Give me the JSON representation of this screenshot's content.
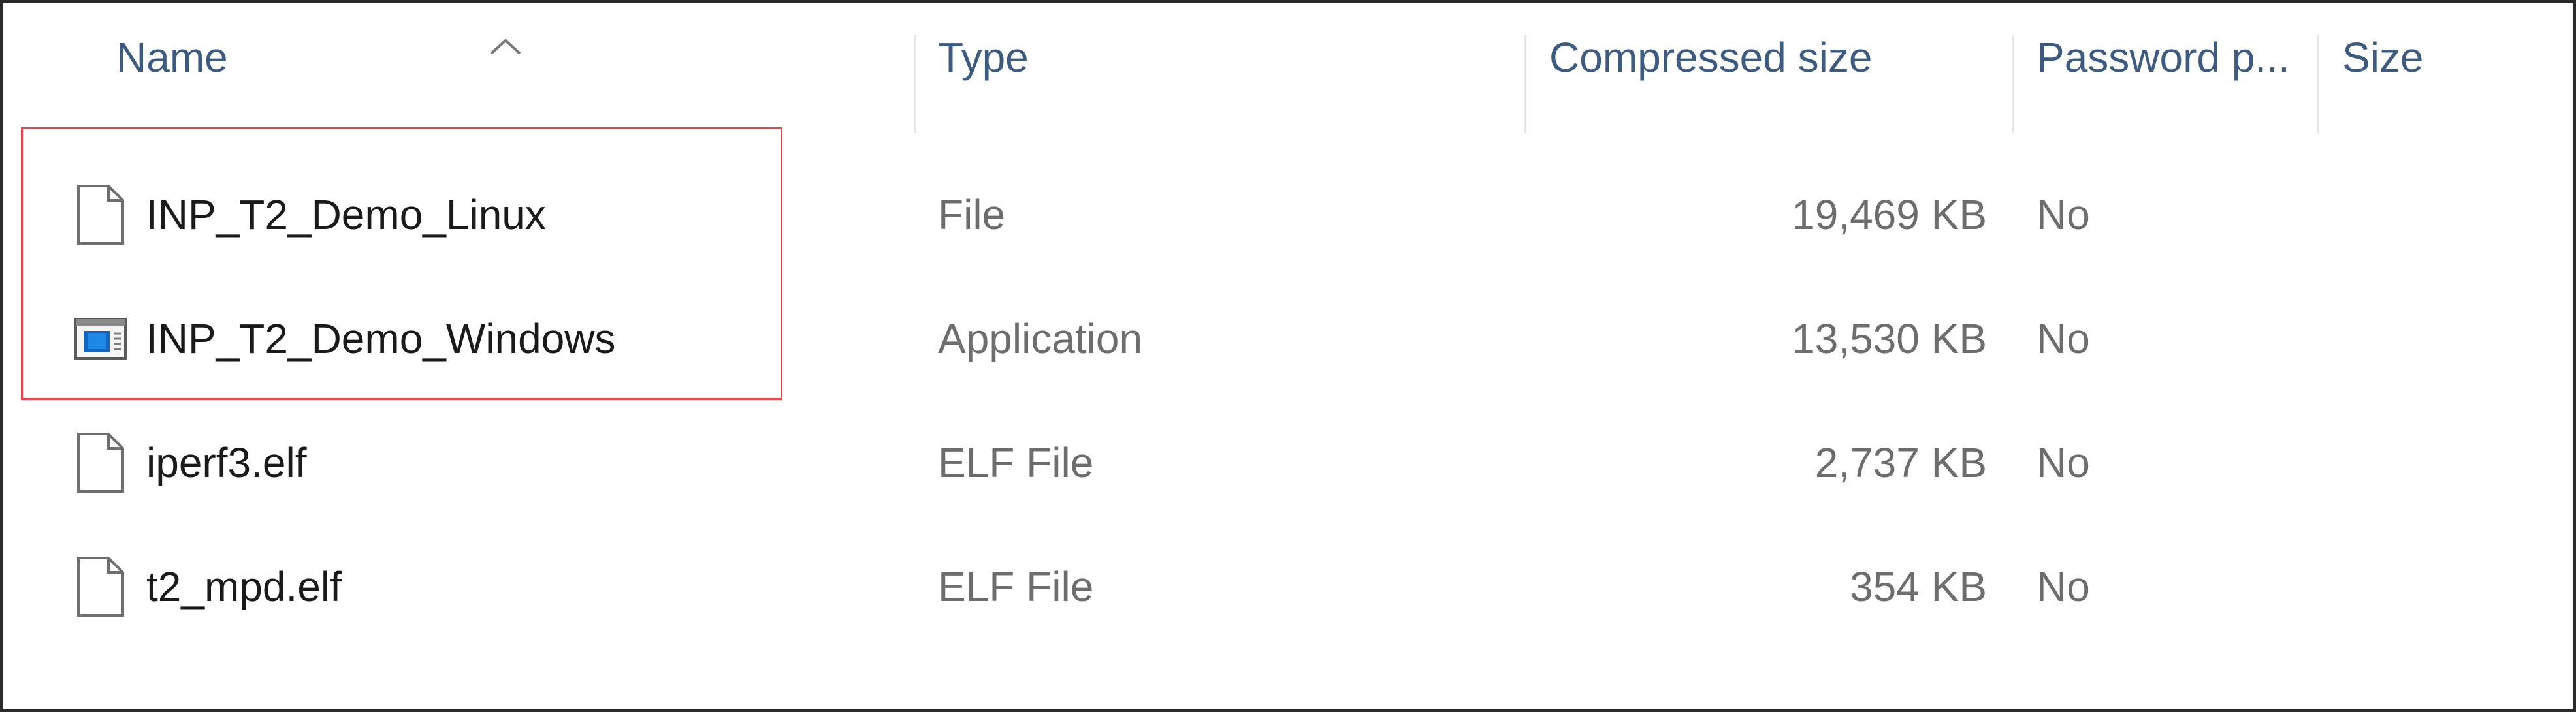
{
  "columns": {
    "name": "Name",
    "type": "Type",
    "compressed_size": "Compressed size",
    "password": "Password p...",
    "size": "Size"
  },
  "rows": [
    {
      "name": "INP_T2_Demo_Linux",
      "type": "File",
      "compressed_size": "19,469 KB",
      "password": "No",
      "icon": "document-icon"
    },
    {
      "name": "INP_T2_Demo_Windows",
      "type": "Application",
      "compressed_size": "13,530 KB",
      "password": "No",
      "icon": "application-window-icon"
    },
    {
      "name": "iperf3.elf",
      "type": "ELF File",
      "compressed_size": "2,737 KB",
      "password": "No",
      "icon": "document-icon"
    },
    {
      "name": "t2_mpd.elf",
      "type": "ELF File",
      "compressed_size": "354 KB",
      "password": "No",
      "icon": "document-icon"
    }
  ],
  "sort": {
    "column": "name",
    "direction": "ascending",
    "icon": "chevron-up-icon"
  },
  "colors": {
    "header_text": "#3d5a80",
    "cell_text": "#1a1a1a",
    "muted_text": "#6d6d6d",
    "highlight": "#e8454a",
    "frame": "#2b2b2b"
  }
}
